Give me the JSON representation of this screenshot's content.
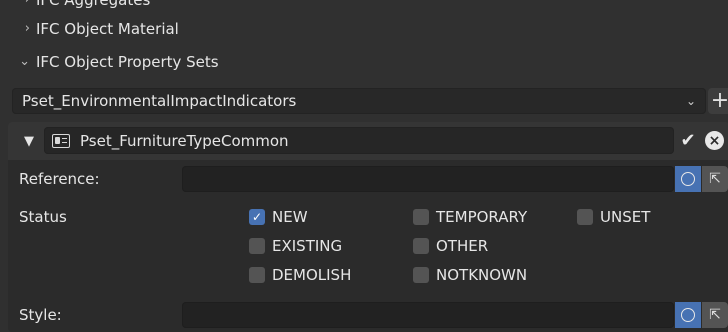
{
  "tree": {
    "items": [
      {
        "label": "IFC Aggregates",
        "chevron": "›"
      },
      {
        "label": "IFC Object Material",
        "chevron": "›"
      },
      {
        "label": "IFC Object Property Sets",
        "chevron": "⌄"
      }
    ]
  },
  "pset_selector": {
    "value": "Pset_EnvironmentalImpactIndicators",
    "add_label": "+",
    "caret": "⌄"
  },
  "pset": {
    "name": "Pset_FurnitureTypeCommon",
    "expand_glyph": "▼",
    "confirm_glyph": "✔",
    "remove_glyph": "×",
    "properties": {
      "reference": {
        "label": "Reference:",
        "value": ""
      },
      "status": {
        "label": "Status",
        "options": [
          {
            "label": "NEW",
            "checked": true
          },
          {
            "label": "TEMPORARY",
            "checked": false
          },
          {
            "label": "UNSET",
            "checked": false
          },
          {
            "label": "EXISTING",
            "checked": false
          },
          {
            "label": "OTHER",
            "checked": false
          },
          {
            "label": "DEMOLISH",
            "checked": false
          },
          {
            "label": "NOTKNOWN",
            "checked": false
          }
        ]
      },
      "style": {
        "label": "Style:",
        "value": ""
      }
    }
  },
  "icons": {
    "check": "✓",
    "pick": "⇱"
  },
  "colors": {
    "accent": "#4772b3",
    "background": "#303030"
  }
}
